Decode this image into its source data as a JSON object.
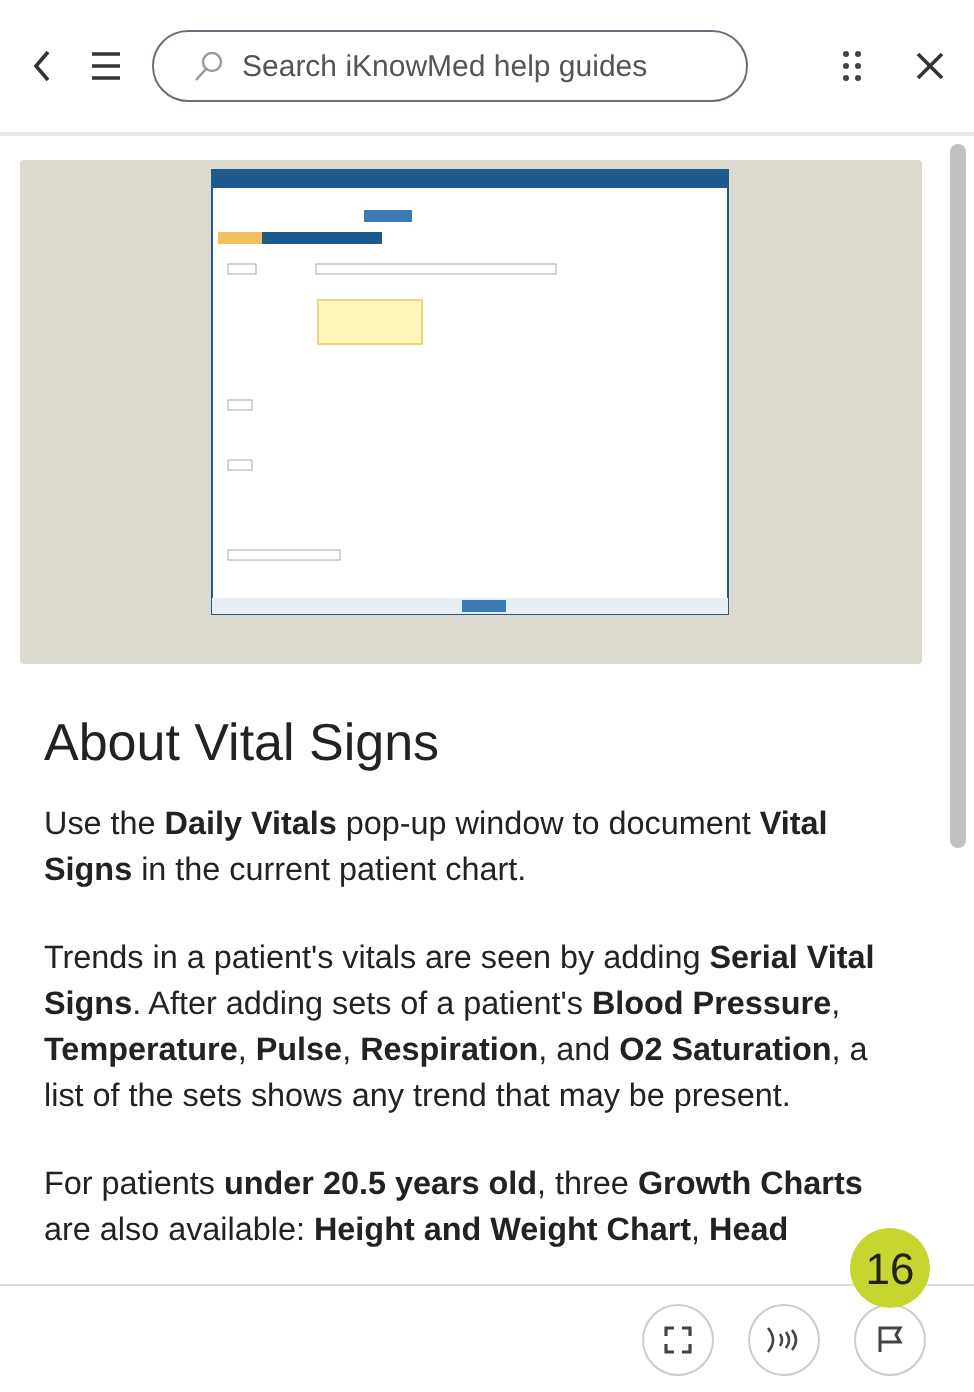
{
  "search": {
    "placeholder": "Search iKnowMed help guides"
  },
  "article": {
    "heading": "About Vital Signs",
    "paragraphs": [
      "Use the **Daily Vitals** pop-up window to document **Vital Signs** in the current patient chart.",
      "Trends in a patient's vitals are seen by adding **Serial Vital Signs**. After adding sets of a patient's **Blood Pressure**, **Temperature**, **Pulse**, **Respiration**, and **O2 Saturation**, a list of the sets shows any trend that may be present.",
      "For patients **under 20.5 years old**, three **Growth Charts** are also available: **Height and Weight Chart**, **Head**"
    ]
  },
  "badge": "16"
}
